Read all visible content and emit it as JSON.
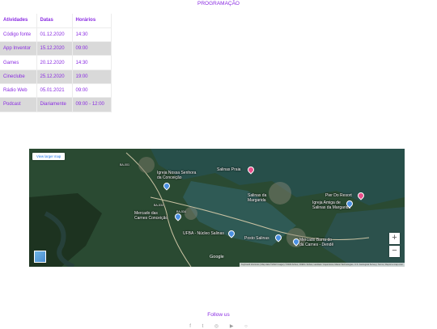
{
  "page": {
    "title": "PROGRAMAÇÃO",
    "follow_label": "Follow us"
  },
  "schedule": {
    "headers": [
      "Atividades",
      "Datas",
      "Horários"
    ],
    "rows": [
      [
        "Código fonte",
        "01.12.2020",
        "14:30"
      ],
      [
        "App Inventor",
        "15.12.2020",
        "09:00"
      ],
      [
        "Games",
        "20.12.2020",
        "14:30"
      ],
      [
        "Cineclube",
        "25.12.2020",
        "19:00"
      ],
      [
        "Rádio Web",
        "05.01.2021",
        "09:00"
      ],
      [
        "Podcast",
        "Diariamente",
        "09:00 - 12:00"
      ]
    ]
  },
  "map": {
    "view_larger_map": "View larger map",
    "zoom_in": "+",
    "zoom_out": "−",
    "google": "Google",
    "attribution": "Keyboard shortcuts | Map data ©2022 Imagery ©2022 Airbus, CNES / Airbus, Landsat / Copernicus, Maxar Technologies, U.S. Geological Survey | Terms | Report a map error",
    "places": {
      "igreja_conceicao": "Igreja Nossa Senhora\nda Conceição",
      "salinas_praia": "Salinas Praia",
      "salinas_margarida": "Salinas da\nMargarida",
      "pier_resort": "Pier Do Resort",
      "igreja_amiga": "Igreja Amiga de\nSalinas da Margarida",
      "mercado_conceicao": "Mercado das\nCarnes Conceição",
      "nucleo_salinas": "UFBA - Núcleo Salinas",
      "posto_salinas": "Posto Salinas",
      "mercado_barra": "Mercado Barra do\nda Carnes - Dendê",
      "road1": "BA-001",
      "road2": "BA-534",
      "road3": "BA-534"
    },
    "colors": {
      "water": "#274f4a",
      "land": "#2c4a2a",
      "pin_pink": "#e94d89",
      "pin_blue": "#4a90e2"
    }
  },
  "social": {
    "icons": [
      "facebook-icon",
      "twitter-icon",
      "instagram-icon",
      "youtube-icon",
      "whatsapp-icon"
    ]
  }
}
